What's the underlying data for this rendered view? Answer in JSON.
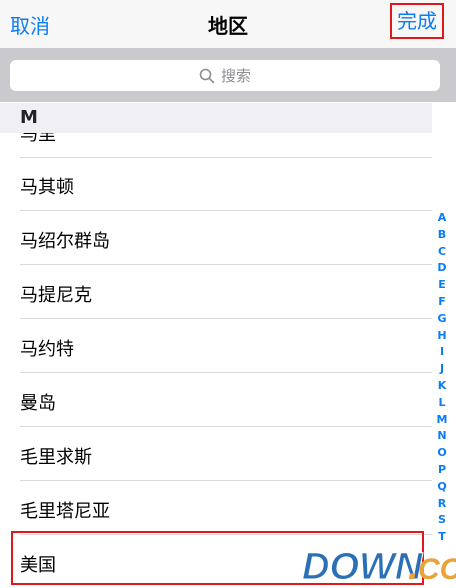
{
  "navbar": {
    "cancel": "取消",
    "title": "地区",
    "done": "完成"
  },
  "search": {
    "placeholder": "搜索",
    "icon": "search-icon"
  },
  "section": {
    "letter": "M"
  },
  "list": {
    "partial_item": "马里",
    "items": [
      "马其顿",
      "马绍尔群岛",
      "马提尼克",
      "马约特",
      "曼岛",
      "毛里求斯",
      "毛里塔尼亚",
      "美国"
    ]
  },
  "index": [
    "A",
    "B",
    "C",
    "D",
    "E",
    "F",
    "G",
    "H",
    "I",
    "J",
    "K",
    "L",
    "M",
    "N",
    "O",
    "P",
    "Q",
    "R",
    "S",
    "T"
  ],
  "watermark": {
    "text_main": "DOWN",
    "text_dot": ".",
    "text_cc": "CC"
  },
  "colors": {
    "accent": "#0a7cf5",
    "highlight": "#e0171b"
  }
}
